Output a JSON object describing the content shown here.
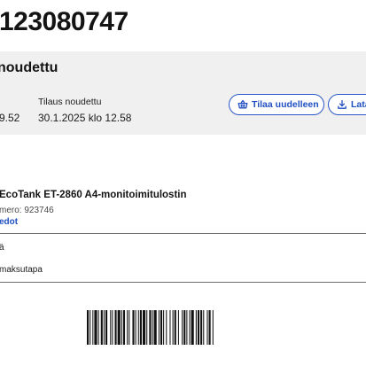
{
  "order": {
    "number": "123080747"
  },
  "status": {
    "title": "noudettu",
    "clipped_value": "9.52",
    "picked_label": "Tilaus noudettu",
    "picked_value": "30.1.2025 klo 12.58",
    "actions": {
      "reorder_label": "Tilaa uudelleen",
      "download_label": "Lata"
    }
  },
  "product": {
    "name": "EcoTank ET-2860 A4-monitoimitulostin",
    "number_label": "mero: 923746",
    "details_link": "edot"
  },
  "info_rows": [
    "ä",
    "maksutapa"
  ],
  "icons": {
    "reorder": "basket-icon",
    "download": "download-icon"
  },
  "colors": {
    "accent": "#1f4fc2",
    "panel_bg": "#f0f0f0",
    "text": "#141414"
  }
}
